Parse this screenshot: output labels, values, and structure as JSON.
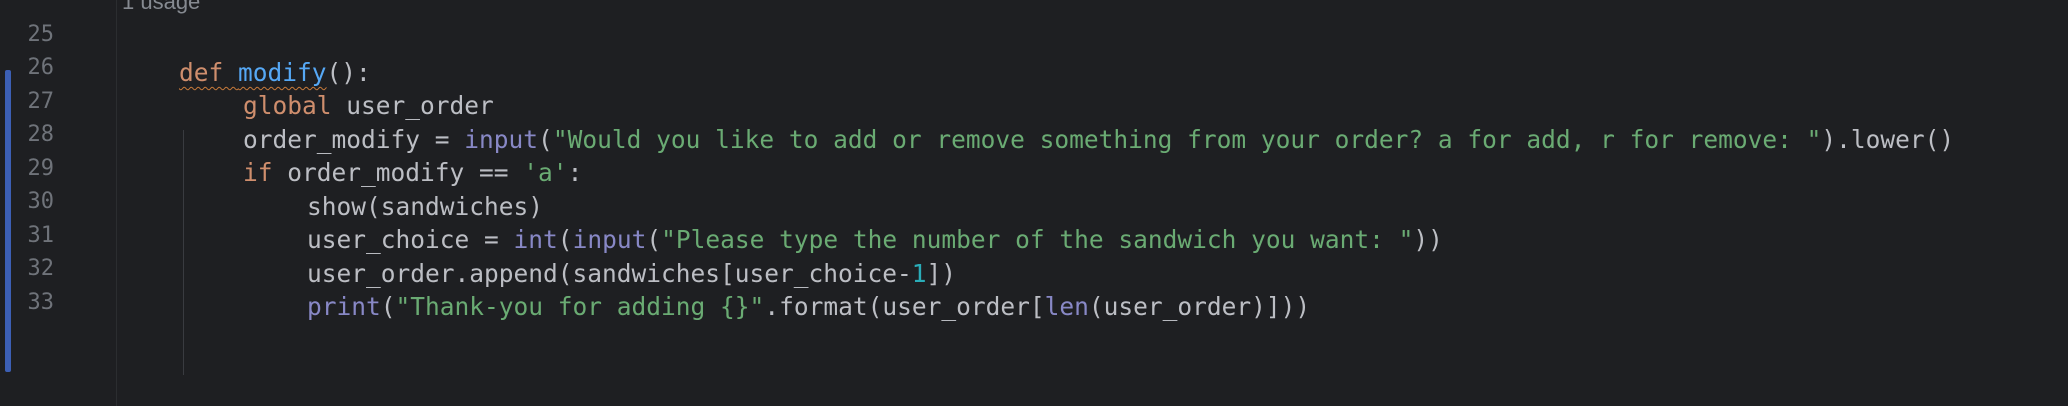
{
  "editor": {
    "inlay_hint": "1 usage",
    "line_numbers": [
      "25",
      "26",
      "27",
      "28",
      "29",
      "30",
      "31",
      "32",
      "33"
    ],
    "lines": {
      "l25": [
        "def ",
        "modify",
        "():"
      ],
      "l26": [
        "global ",
        "user_order"
      ],
      "l27": [
        "order_modify = ",
        "input",
        "(",
        "\"Would you like to add or remove something from your order? a for add, r for remove: \"",
        ").lower()"
      ],
      "l28": [
        "if ",
        "order_modify == ",
        "'a'",
        ":"
      ],
      "l29": [
        "show(sandwiches)"
      ],
      "l30": [
        "user_choice = ",
        "int",
        "(",
        "input",
        "(",
        "\"Please type the number of the sandwich you want: \"",
        "))"
      ],
      "l31": [
        "user_order.append(sandwiches[user_choice-",
        "1",
        "])"
      ],
      "l32": [
        "print",
        "(",
        "\"Thank-you for adding {}\"",
        ".format(user_order[",
        "len",
        "(user_order)]))"
      ]
    },
    "colors": {
      "background": "#1e1f22",
      "keyword": "#cf8e6d",
      "function": "#56a8f5",
      "string": "#6aab73",
      "number": "#2aacb8",
      "builtin": "#8888c6",
      "text": "#bcbec4",
      "line_number": "#6f737a",
      "change_marker": "#3c5fb4"
    }
  }
}
